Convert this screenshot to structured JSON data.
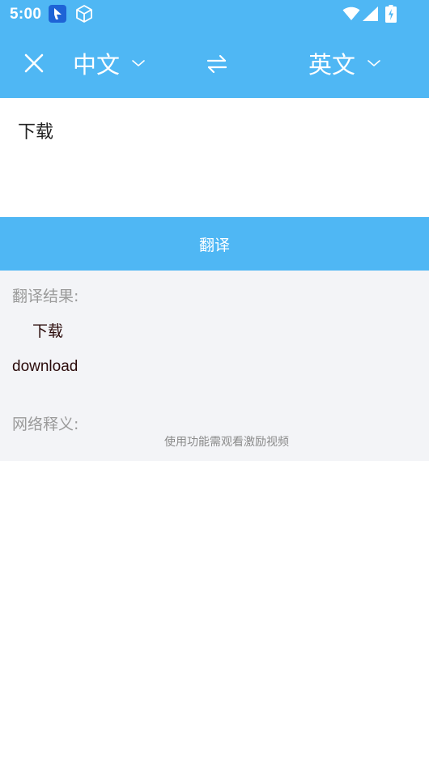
{
  "status_bar": {
    "time": "5:00",
    "icons": [
      "app-notification-icon",
      "package-box-icon",
      "wifi-icon",
      "cell-signal-icon",
      "battery-charging-icon"
    ]
  },
  "toolbar": {
    "close_icon": "close-icon",
    "source_language": "中文",
    "swap_icon": "swap-arrows-icon",
    "target_language": "英文",
    "dropdown_icon": "chevron-down-icon"
  },
  "input": {
    "text": "下载"
  },
  "translate_button": {
    "label": "翻译"
  },
  "result": {
    "header": "翻译结果:",
    "source_text": "下载",
    "translated_text": "download",
    "web_header": "网络释义:",
    "video_hint": "使用功能需观看激励视频"
  },
  "colors": {
    "accent": "#4fb7f4",
    "panel_background": "#f3f4f7",
    "muted_text": "#9a9a9a",
    "result_text": "#2a0a0a"
  }
}
